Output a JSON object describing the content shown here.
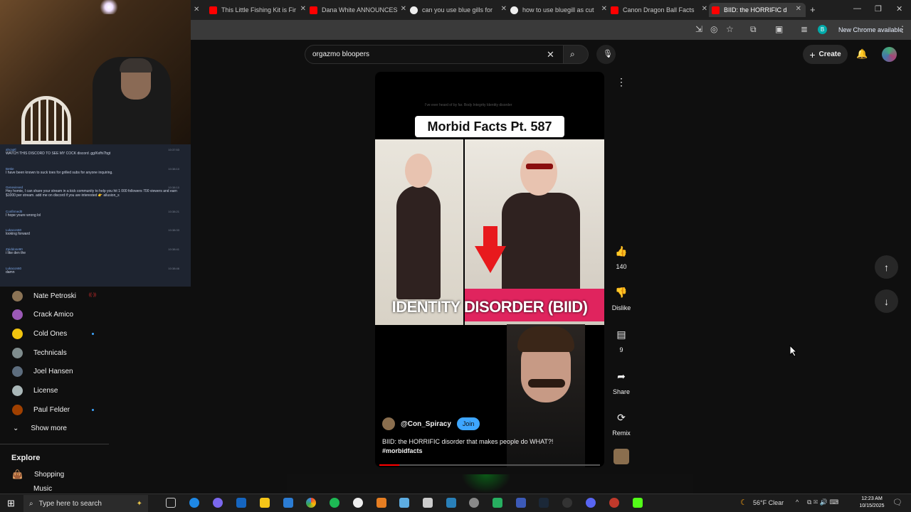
{
  "browser": {
    "tabs": [
      {
        "title": "This Little Fishing Kit is Fir",
        "icon": "youtube"
      },
      {
        "title": "Dana White ANNOUNCES",
        "icon": "youtube"
      },
      {
        "title": "can you use blue gills for",
        "icon": "chrome"
      },
      {
        "title": "how to use bluegill as cut",
        "icon": "chrome"
      },
      {
        "title": "Canon Dragon Ball Facts",
        "icon": "youtube"
      },
      {
        "title": "BIID: the HORRIFIC d",
        "icon": "youtube"
      }
    ],
    "new_chrome_label": "New Chrome available",
    "profile_letter": "B"
  },
  "youtube": {
    "search_query": "orgazmo bloopers",
    "create_label": "Create"
  },
  "chat": [
    {
      "user": "ahcaptl",
      "text": "WATCH THIS DISCORD TO SEE MY COCK discord .gg/Kxfhi7bgt",
      "time": "10:37:53"
    },
    {
      "user": "Bettie",
      "text": "I have been known to suck toes for grilled subs for anyone inquiring.",
      "time": "10:38:10"
    },
    {
      "user": "Genevieved",
      "text": "Hey homie, I can share your stream in a kick community to help you hit 1 000 followers 700 viewers and earn $1000 per stream. add me on discord if you are interested 👉 allusion_s",
      "time": "10:38:10"
    },
    {
      "user": "Confirmed0",
      "text": "I hope youre wrong lol",
      "time": "10:38:21"
    },
    {
      "user": "Lukacon60",
      "text": "looking forward",
      "time": "10:38:33"
    },
    {
      "user": "Zpiddone90",
      "text": "i like den the",
      "time": "10:38:41"
    },
    {
      "user": "Lukacon60",
      "text": "damn",
      "time": "10:38:46"
    }
  ],
  "sidebar": {
    "subscriptions": [
      {
        "name": "Nate Petroski",
        "live": true,
        "color": "#8b7355"
      },
      {
        "name": "Crack Amico",
        "live": false,
        "color": "#9b59b6"
      },
      {
        "name": "Cold Ones",
        "live": false,
        "new": true,
        "color": "#f1c40f"
      },
      {
        "name": "Technicals",
        "live": false,
        "color": "#7f8c8d"
      },
      {
        "name": "Joel Hansen",
        "live": false,
        "color": "#5d6d7e"
      },
      {
        "name": "License",
        "live": false,
        "color": "#aab7b8"
      },
      {
        "name": "Paul Felder",
        "live": false,
        "new": true,
        "color": "#a04000"
      }
    ],
    "show_more_label": "Show more",
    "explore_heading": "Explore",
    "explore_items": [
      "Shopping",
      "Music"
    ]
  },
  "short": {
    "overlay_title": "Morbid Facts Pt. 587",
    "tiny_text": "I've ever heard of by far. Body Integrity Identity disorder",
    "banner_text": "IDENTITY DISORDER (BIID)",
    "channel": "@Con_Spiracy",
    "join_label": "Join",
    "description": "BIID: the HORRIFIC disorder that makes people do WHAT?!",
    "hashtag": "#morbidfacts",
    "progress": 0.09
  },
  "actions": {
    "likes": "140",
    "dislike_label": "Dislike",
    "comments": "9",
    "share_label": "Share",
    "remix_label": "Remix"
  },
  "taskbar": {
    "search_placeholder": "Type here to search",
    "weather": "56°F  Clear",
    "time": "12:23 AM",
    "date": "10/15/2025"
  }
}
